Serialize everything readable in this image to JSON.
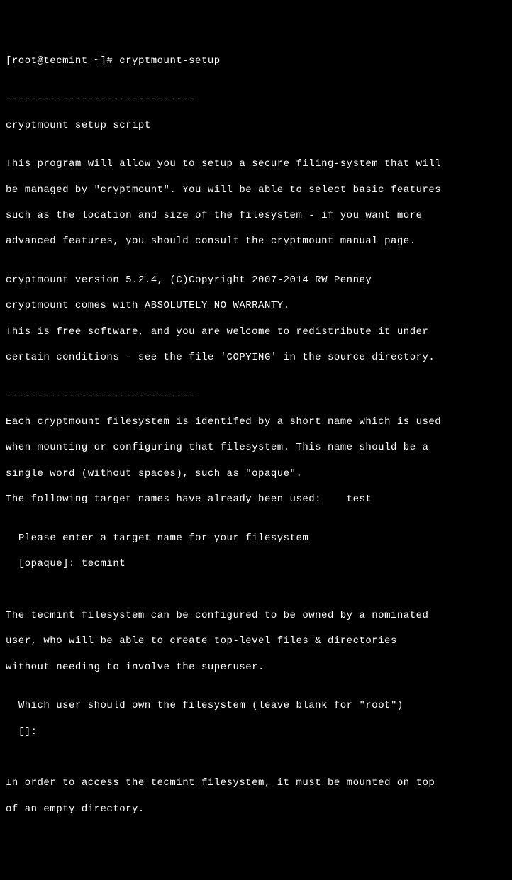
{
  "prompt": {
    "user_host": "[root@tecmint ~]# ",
    "command": "cryptmount-setup"
  },
  "output": {
    "blank1": "",
    "divider1": "------------------------------",
    "title": "cryptmount setup script",
    "blank2": "",
    "intro1": "This program will allow you to setup a secure filing-system that will",
    "intro2": "be managed by \"cryptmount\". You will be able to select basic features",
    "intro3": "such as the location and size of the filesystem - if you want more",
    "intro4": "advanced features, you should consult the cryptmount manual page.",
    "blank3": "",
    "version": "cryptmount version 5.2.4, (C)Copyright 2007-2014 RW Penney",
    "warranty": "cryptmount comes with ABSOLUTELY NO WARRANTY.",
    "license1": "This is free software, and you are welcome to redistribute it under",
    "license2": "certain conditions - see the file 'COPYING' in the source directory.",
    "blank4": "",
    "divider2": "------------------------------",
    "fs1": "Each cryptmount filesystem is identifed by a short name which is used",
    "fs2": "when mounting or configuring that filesystem. This name should be a",
    "fs3": "single word (without spaces), such as \"opaque\".",
    "fs4": "The following target names have already been used:    test",
    "blank5": "",
    "prompt1": "  Please enter a target name for your filesystem",
    "prompt1_input": "  [opaque]: tecmint",
    "blank6": "",
    "blank7": "",
    "owner1": "The tecmint filesystem can be configured to be owned by a nominated",
    "owner2": "user, who will be able to create top-level files & directories",
    "owner3": "without needing to involve the superuser.",
    "blank8": "",
    "prompt2": "  Which user should own the filesystem (leave blank for \"root\")",
    "prompt2_input": "  []:",
    "blank9": "",
    "blank10": "",
    "mount1": "In order to access the tecmint filesystem, it must be mounted on top",
    "mount2": "of an empty directory."
  }
}
